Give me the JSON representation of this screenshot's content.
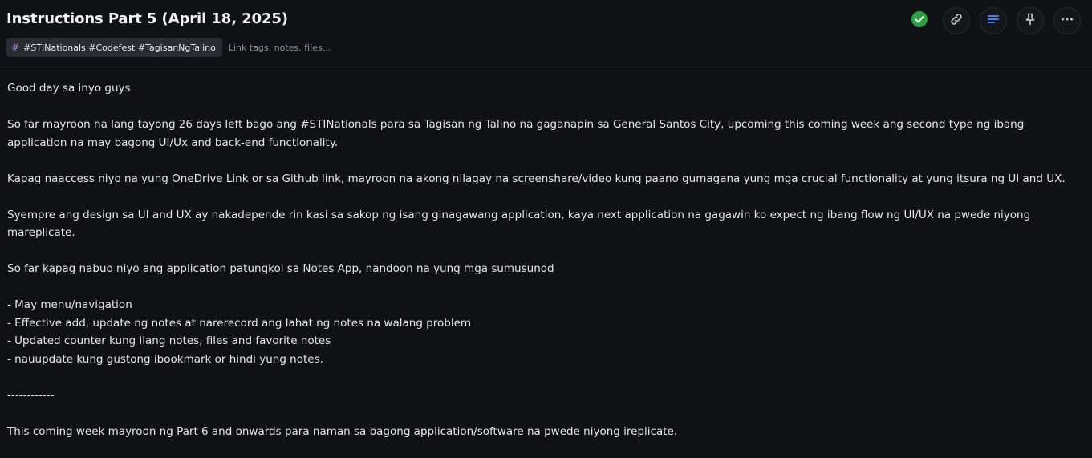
{
  "note": {
    "title": "Instructions Part 5 (April 18, 2025)",
    "tags": "#STINationals #Codefest #TagisanNgTalino",
    "tag_placeholder": "Link tags, notes, files...",
    "paragraphs": [
      "Good day sa inyo guys",
      "",
      "So far mayroon na lang tayong 26 days left bago ang #STINationals para sa Tagisan ng Talino na gaganapin sa General Santos City, upcoming this coming week ang second type ng ibang application na may bagong UI/Ux and back-end functionality.",
      "",
      "Kapag naaccess niyo na yung OneDrive Link or sa Github link, mayroon na akong nilagay na screenshare/video kung paano gumagana yung mga crucial functionality at yung itsura ng UI and UX.",
      "",
      "Syempre ang design sa UI and UX ay nakadepende rin kasi sa sakop ng isang ginagawang application, kaya next application na gagawin ko expect ng ibang flow ng UI/UX na pwede niyong mareplicate.",
      "",
      "So far kapag nabuo niyo ang application patungkol sa Notes App, nandoon na yung mga sumusunod",
      "",
      "- May menu/navigation",
      "- Effective add, update ng notes at narerecord ang lahat ng notes na walang problem",
      "- Updated counter kung ilang notes, files and favorite notes",
      "- nauupdate kung gustong ibookmark or hindi yung notes.",
      "",
      "------------",
      "",
      "This coming week mayroon ng Part 6 and onwards para naman sa bagong application/software na pwede niyong ireplicate."
    ]
  },
  "toolbar": {
    "icons": [
      "check-circle-icon",
      "link-icon",
      "format-icon",
      "pin-icon",
      "more-icon"
    ],
    "colors": {
      "check": "#2ea043",
      "format_accent": "#3b82f6",
      "icon": "#c9c9ce",
      "tag_hash": "#b07ad6"
    }
  }
}
